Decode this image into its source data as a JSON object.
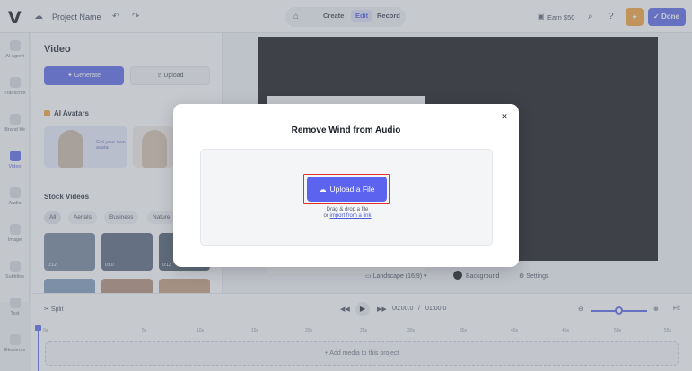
{
  "topbar": {
    "logo": "V",
    "project_name": "Project Name",
    "modes": [
      "Create",
      "Edit",
      "Record"
    ],
    "active_mode": "Edit",
    "earn_label": "Earn $50",
    "done_label": "Done"
  },
  "rail": {
    "items": [
      {
        "label": "AI Agent"
      },
      {
        "label": "Transcript"
      },
      {
        "label": "Brand Kit"
      },
      {
        "label": "Video"
      },
      {
        "label": "Audio"
      },
      {
        "label": "Image"
      },
      {
        "label": "Subtitles"
      },
      {
        "label": "Text"
      },
      {
        "label": "Elements"
      }
    ],
    "active_index": 3
  },
  "panel": {
    "title": "Video",
    "generate_label": "Generate",
    "upload_label": "Upload",
    "avatars_heading": "AI Avatars",
    "avatar_card_text": "Get your own avatar",
    "stock_heading": "Stock Videos",
    "chips": [
      "All",
      "Aerials",
      "Business",
      "Nature"
    ],
    "thumb_labels": [
      "0:12",
      "0:10",
      "0:13"
    ]
  },
  "stage": {
    "landscape_label": "Landscape (16:9)",
    "background_label": "Background",
    "settings_label": "Settings"
  },
  "timeline": {
    "split_label": "Split",
    "time_current": "00:00.0",
    "time_separator": "/",
    "time_total": "01:00.0",
    "fit_label": "Fit",
    "ruler_marks": [
      "0s",
      "5s",
      "10s",
      "15s",
      "20s",
      "25s",
      "30s",
      "35s",
      "40s",
      "45s",
      "50s",
      "55s"
    ],
    "add_media_label": "+ Add media to this project"
  },
  "modal": {
    "title": "Remove Wind from Audio",
    "upload_label": "Upload a File",
    "drag_text": "Drag & drop a file",
    "or_text": "or",
    "import_link": "import from a link"
  }
}
